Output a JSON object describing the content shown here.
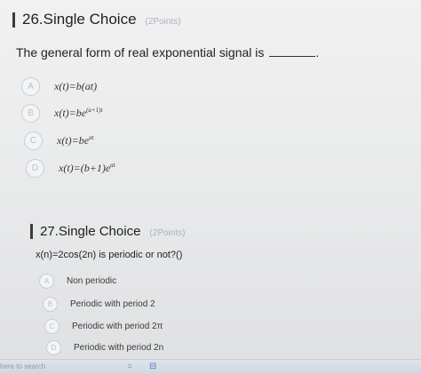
{
  "q26": {
    "title": "26.Single Choice",
    "points": "(2Points)",
    "stem": "The general form of real exponential signal is",
    "options": [
      {
        "letter": "A",
        "text": "x(t)=b(at)"
      },
      {
        "letter": "B",
        "text": "x(t)=be",
        "sup": "(a+1)t"
      },
      {
        "letter": "C",
        "text": "x(t)=be",
        "sup": "at"
      },
      {
        "letter": "D",
        "text": "x(t)=(b+1)e",
        "sup": "at"
      }
    ]
  },
  "q27": {
    "title": "27.Single Choice",
    "points": "(2Points)",
    "stem": "x(n)=2cos(2n) is periodic or not?()",
    "options": [
      {
        "letter": "A",
        "text": "Non periodic"
      },
      {
        "letter": "B",
        "text": "Periodic with period 2"
      },
      {
        "letter": "C",
        "text": "Periodic with period 2π"
      },
      {
        "letter": "D",
        "text": "Periodic with period 2n"
      }
    ]
  },
  "taskbar": {
    "search_text": "here to search",
    "search_icon": "circle-search-icon",
    "app_icon": "task-view-icon"
  }
}
